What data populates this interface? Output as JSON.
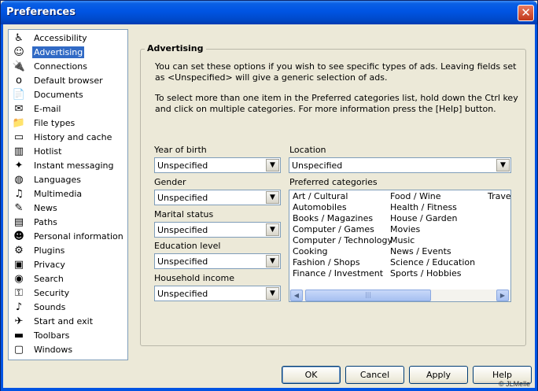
{
  "window": {
    "title": "Preferences"
  },
  "sidebar": {
    "items": [
      {
        "label": "Accessibility",
        "icon": "♿"
      },
      {
        "label": "Advertising",
        "icon": "☺"
      },
      {
        "label": "Connections",
        "icon": "🔌"
      },
      {
        "label": "Default browser",
        "icon": "o"
      },
      {
        "label": "Documents",
        "icon": "📄"
      },
      {
        "label": "E-mail",
        "icon": "✉"
      },
      {
        "label": "File types",
        "icon": "📁"
      },
      {
        "label": "History and cache",
        "icon": "▭"
      },
      {
        "label": "Hotlist",
        "icon": "▥"
      },
      {
        "label": "Instant messaging",
        "icon": "✦"
      },
      {
        "label": "Languages",
        "icon": "◍"
      },
      {
        "label": "Multimedia",
        "icon": "♫"
      },
      {
        "label": "News",
        "icon": "✎"
      },
      {
        "label": "Paths",
        "icon": "▤"
      },
      {
        "label": "Personal information",
        "icon": "☻"
      },
      {
        "label": "Plugins",
        "icon": "⚙"
      },
      {
        "label": "Privacy",
        "icon": "▣"
      },
      {
        "label": "Search",
        "icon": "◉"
      },
      {
        "label": "Security",
        "icon": "⚿"
      },
      {
        "label": "Sounds",
        "icon": "♪"
      },
      {
        "label": "Start and exit",
        "icon": "✈"
      },
      {
        "label": "Toolbars",
        "icon": "▬"
      },
      {
        "label": "Windows",
        "icon": "▢"
      }
    ],
    "selected": "Advertising"
  },
  "advertising": {
    "heading": "Advertising",
    "intro1": "You can set these options if you wish to see specific types of ads. Leaving fields set as <Unspecified> will give a generic selection of ads.",
    "intro2": "To select more than one item in the Preferred categories list, hold down the Ctrl key and click on multiple categories. For more information press the [Help] button.",
    "year_of_birth": {
      "label": "Year of birth",
      "value": "Unspecified"
    },
    "gender": {
      "label": "Gender",
      "value": "Unspecified"
    },
    "marital_status": {
      "label": "Marital status",
      "value": "Unspecified"
    },
    "education_level": {
      "label": "Education level",
      "value": "Unspecified"
    },
    "household_income": {
      "label": "Household income",
      "value": "Unspecified"
    },
    "location": {
      "label": "Location",
      "value": "Unspecified"
    },
    "preferred_categories": {
      "label": "Preferred categories",
      "columns": [
        [
          "Art / Cultural",
          "Automobiles",
          "Books / Magazines",
          "Computer / Games",
          "Computer / Technology",
          "Cooking",
          "Fashion / Shops",
          "Finance / Investment"
        ],
        [
          "Food / Wine",
          "Health / Fitness",
          "House / Garden",
          "Movies",
          "Music",
          "News / Events",
          "Science / Education",
          "Sports / Hobbies"
        ],
        [
          "Trave"
        ]
      ]
    }
  },
  "buttons": {
    "ok": "OK",
    "cancel": "Cancel",
    "apply": "Apply",
    "help": "Help"
  },
  "watermark": "© JLMelle"
}
